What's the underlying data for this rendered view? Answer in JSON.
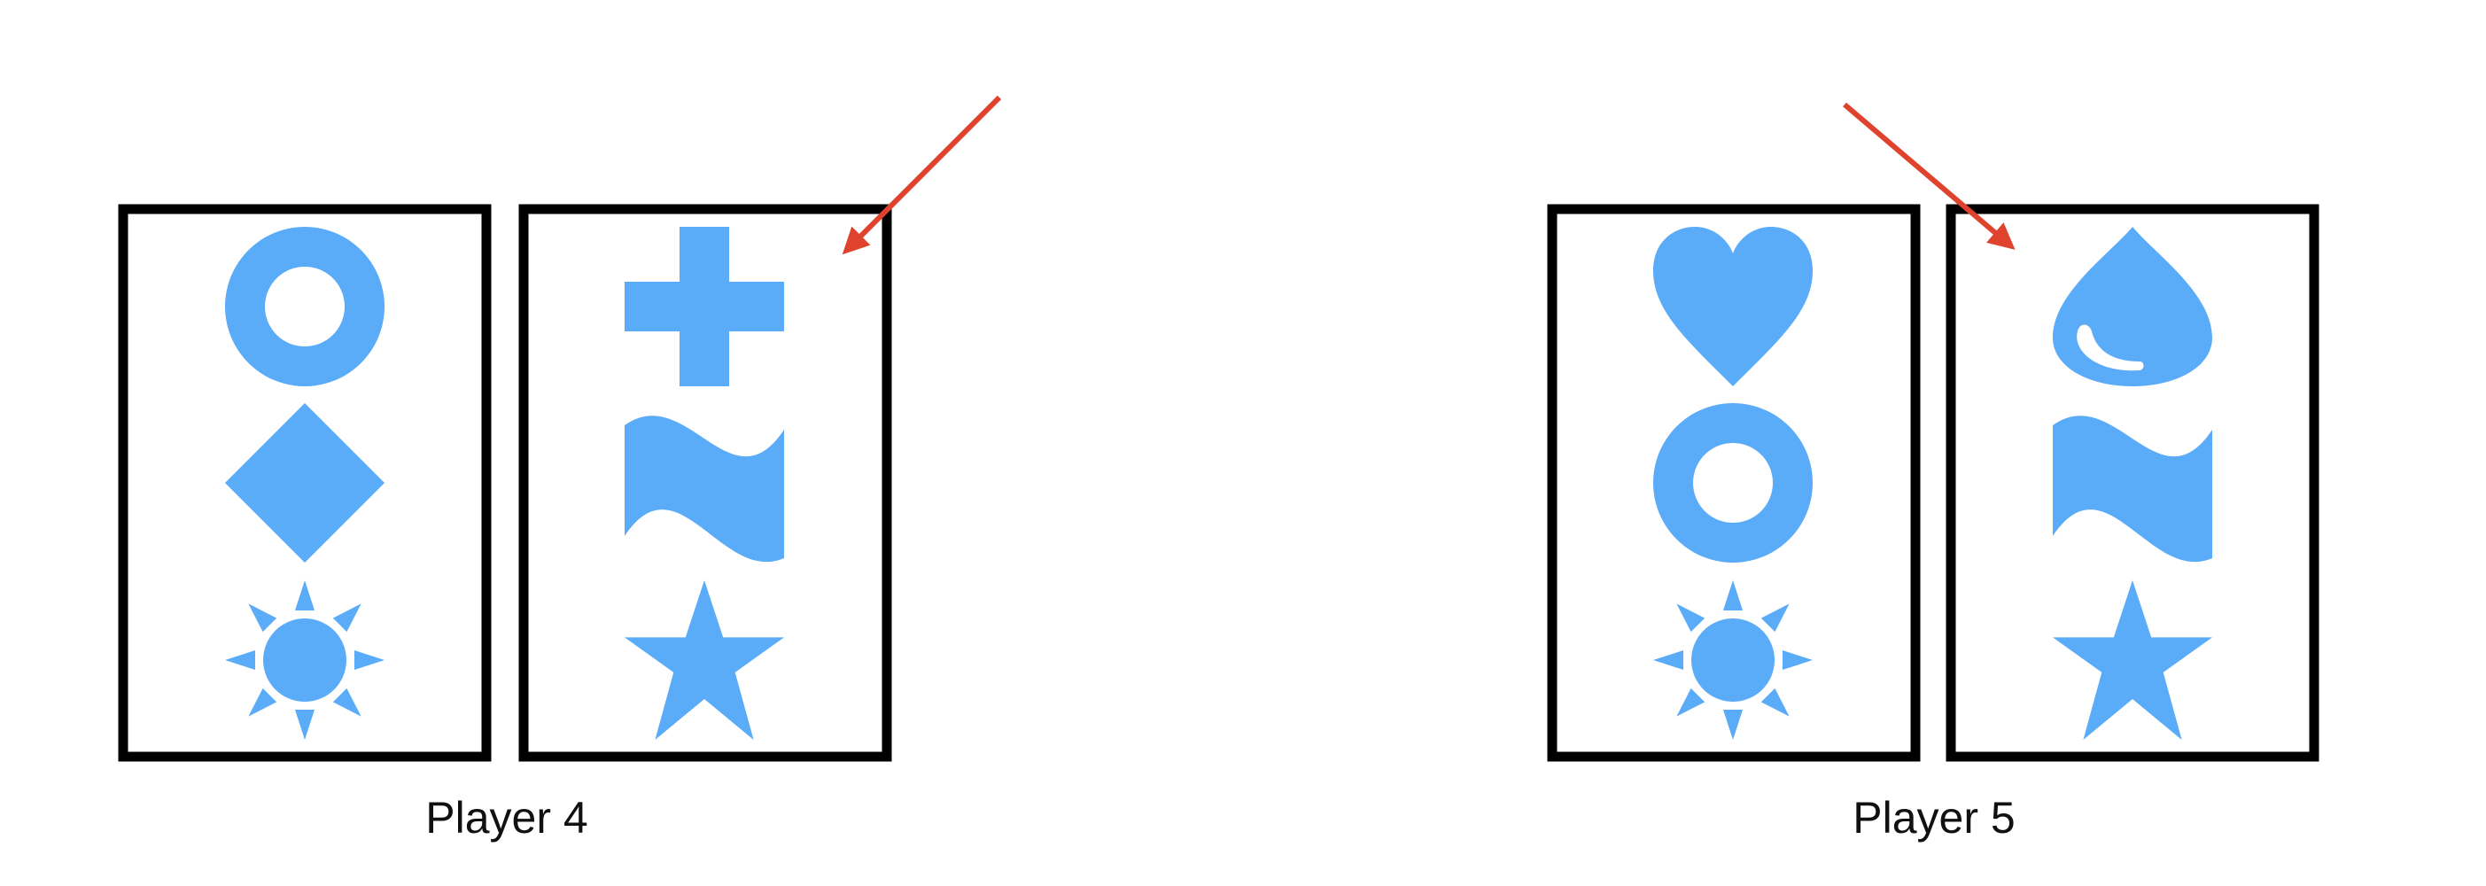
{
  "symbol_color": "#5aabf8",
  "arrow_color": "#e0432d",
  "players": [
    {
      "label": "Player 4",
      "cards": [
        {
          "symbols": [
            "ring-icon",
            "diamond-icon",
            "sun-icon"
          ]
        },
        {
          "symbols": [
            "plus-icon",
            "wave-icon",
            "star-icon"
          ]
        }
      ],
      "arrow_points_to": "card 2 (right card)"
    },
    {
      "label": "Player 5",
      "cards": [
        {
          "symbols": [
            "heart-icon",
            "ring-icon",
            "sun-icon"
          ]
        },
        {
          "symbols": [
            "drop-icon",
            "wave-icon",
            "star-icon"
          ]
        }
      ],
      "arrow_points_to": "card 2 (right card)"
    }
  ]
}
